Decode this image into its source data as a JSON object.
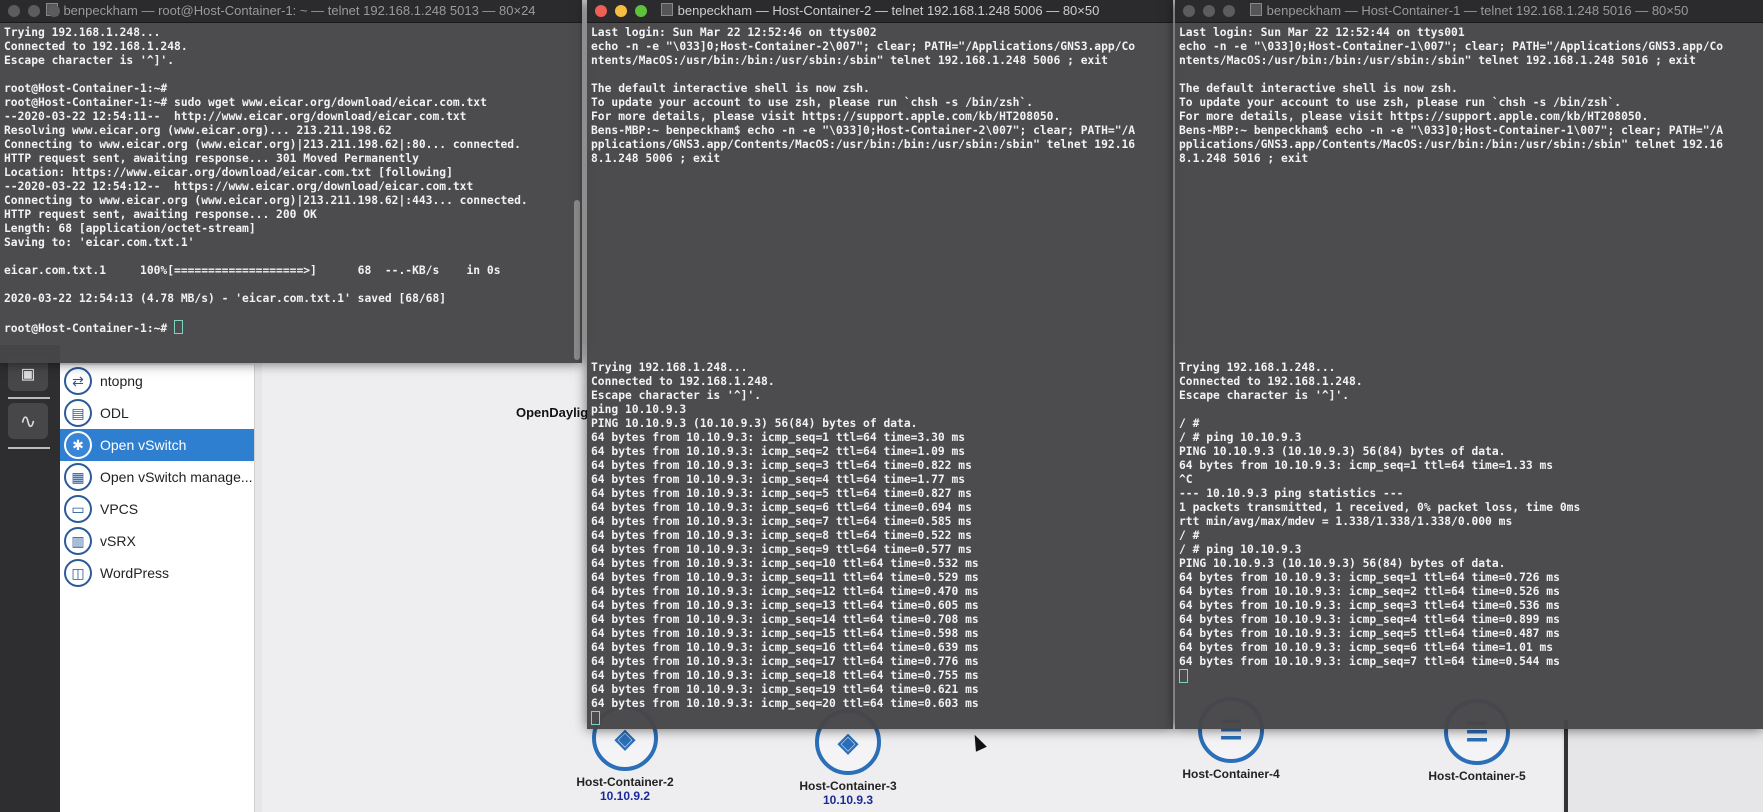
{
  "windows": [
    {
      "title": "benpeckham — root@Host-Container-1: ~ — telnet 192.168.1.248 5013 — 80×24",
      "lines_a": [
        "Trying 192.168.1.248...",
        "Connected to 192.168.1.248.",
        "Escape character is '^]'.",
        "",
        "root@Host-Container-1:~#",
        "root@Host-Container-1:~# sudo wget www.eicar.org/download/eicar.com.txt",
        "--2020-03-22 12:54:11--  http://www.eicar.org/download/eicar.com.txt",
        "Resolving www.eicar.org (www.eicar.org)... 213.211.198.62",
        "Connecting to www.eicar.org (www.eicar.org)|213.211.198.62|:80... connected.",
        "HTTP request sent, awaiting response... 301 Moved Permanently",
        "Location: https://www.eicar.org/download/eicar.com.txt [following]",
        "--2020-03-22 12:54:12--  https://www.eicar.org/download/eicar.com.txt",
        "Connecting to www.eicar.org (www.eicar.org)|213.211.198.62|:443... connected.",
        "HTTP request sent, awaiting response... 200 OK",
        "Length: 68 [application/octet-stream]",
        "Saving to: 'eicar.com.txt.1'",
        "",
        "eicar.com.txt.1     100%[===================>]      68  --.-KB/s    in 0s",
        "",
        "2020-03-22 12:54:13 (4.78 MB/s) - 'eicar.com.txt.1' saved [68/68]",
        "",
        "root@Host-Container-1:~# "
      ]
    },
    {
      "title": "benpeckham — Host-Container-2 — telnet 192.168.1.248 5006 — 80×50",
      "lines_a": [
        "Last login: Sun Mar 22 12:52:46 on ttys002",
        "echo -n -e \"\\033]0;Host-Container-2\\007\"; clear; PATH=\"/Applications/GNS3.app/Co",
        "ntents/MacOS:/usr/bin:/bin:/usr/sbin:/sbin\" telnet 192.168.1.248 5006 ; exit",
        "",
        "The default interactive shell is now zsh.",
        "To update your account to use zsh, please run `chsh -s /bin/zsh`.",
        "For more details, please visit https://support.apple.com/kb/HT208050.",
        "Bens-MBP:~ benpeckham$ echo -n -e \"\\033]0;Host-Container-2\\007\"; clear; PATH=\"/A",
        "pplications/GNS3.app/Contents/MacOS:/usr/bin:/bin:/usr/sbin:/sbin\" telnet 192.16",
        "8.1.248 5006 ; exit"
      ],
      "lines_b": [
        "Trying 192.168.1.248...",
        "Connected to 192.168.1.248.",
        "Escape character is '^]'.",
        "ping 10.10.9.3",
        "PING 10.10.9.3 (10.10.9.3) 56(84) bytes of data.",
        "64 bytes from 10.10.9.3: icmp_seq=1 ttl=64 time=3.30 ms",
        "64 bytes from 10.10.9.3: icmp_seq=2 ttl=64 time=1.09 ms",
        "64 bytes from 10.10.9.3: icmp_seq=3 ttl=64 time=0.822 ms",
        "64 bytes from 10.10.9.3: icmp_seq=4 ttl=64 time=1.77 ms",
        "64 bytes from 10.10.9.3: icmp_seq=5 ttl=64 time=0.827 ms",
        "64 bytes from 10.10.9.3: icmp_seq=6 ttl=64 time=0.694 ms",
        "64 bytes from 10.10.9.3: icmp_seq=7 ttl=64 time=0.585 ms",
        "64 bytes from 10.10.9.3: icmp_seq=8 ttl=64 time=0.522 ms",
        "64 bytes from 10.10.9.3: icmp_seq=9 ttl=64 time=0.577 ms",
        "64 bytes from 10.10.9.3: icmp_seq=10 ttl=64 time=0.532 ms",
        "64 bytes from 10.10.9.3: icmp_seq=11 ttl=64 time=0.529 ms",
        "64 bytes from 10.10.9.3: icmp_seq=12 ttl=64 time=0.470 ms",
        "64 bytes from 10.10.9.3: icmp_seq=13 ttl=64 time=0.605 ms",
        "64 bytes from 10.10.9.3: icmp_seq=14 ttl=64 time=0.708 ms",
        "64 bytes from 10.10.9.3: icmp_seq=15 ttl=64 time=0.598 ms",
        "64 bytes from 10.10.9.3: icmp_seq=16 ttl=64 time=0.639 ms",
        "64 bytes from 10.10.9.3: icmp_seq=17 ttl=64 time=0.776 ms",
        "64 bytes from 10.10.9.3: icmp_seq=18 ttl=64 time=0.755 ms",
        "64 bytes from 10.10.9.3: icmp_seq=19 ttl=64 time=0.621 ms",
        "64 bytes from 10.10.9.3: icmp_seq=20 ttl=64 time=0.603 ms"
      ]
    },
    {
      "title": "benpeckham — Host-Container-1 — telnet 192.168.1.248 5016 — 80×50",
      "lines_a": [
        "Last login: Sun Mar 22 12:52:44 on ttys001",
        "echo -n -e \"\\033]0;Host-Container-1\\007\"; clear; PATH=\"/Applications/GNS3.app/Co",
        "ntents/MacOS:/usr/bin:/bin:/usr/sbin:/sbin\" telnet 192.168.1.248 5016 ; exit",
        "",
        "The default interactive shell is now zsh.",
        "To update your account to use zsh, please run `chsh -s /bin/zsh`.",
        "For more details, please visit https://support.apple.com/kb/HT208050.",
        "Bens-MBP:~ benpeckham$ echo -n -e \"\\033]0;Host-Container-1\\007\"; clear; PATH=\"/A",
        "pplications/GNS3.app/Contents/MacOS:/usr/bin:/bin:/usr/sbin:/sbin\" telnet 192.16",
        "8.1.248 5016 ; exit"
      ],
      "lines_b": [
        "Trying 192.168.1.248...",
        "Connected to 192.168.1.248.",
        "Escape character is '^]'.",
        "",
        "/ #",
        "/ # ping 10.10.9.3",
        "PING 10.10.9.3 (10.10.9.3) 56(84) bytes of data.",
        "64 bytes from 10.10.9.3: icmp_seq=1 ttl=64 time=1.33 ms",
        "^C",
        "--- 10.10.9.3 ping statistics ---",
        "1 packets transmitted, 1 received, 0% packet loss, time 0ms",
        "rtt min/avg/max/mdev = 1.338/1.338/1.338/0.000 ms",
        "/ #",
        "/ # ping 10.10.9.3",
        "PING 10.10.9.3 (10.10.9.3) 56(84) bytes of data.",
        "64 bytes from 10.10.9.3: icmp_seq=1 ttl=64 time=0.726 ms",
        "64 bytes from 10.10.9.3: icmp_seq=2 ttl=64 time=0.526 ms",
        "64 bytes from 10.10.9.3: icmp_seq=3 ttl=64 time=0.536 ms",
        "64 bytes from 10.10.9.3: icmp_seq=4 ttl=64 time=0.899 ms",
        "64 bytes from 10.10.9.3: icmp_seq=5 ttl=64 time=0.487 ms",
        "64 bytes from 10.10.9.3: icmp_seq=6 ttl=64 time=1.01 ms",
        "64 bytes from 10.10.9.3: icmp_seq=7 ttl=64 time=0.544 ms"
      ]
    }
  ],
  "device_list": [
    {
      "label": "ntopng",
      "icon": "ntopng-icon"
    },
    {
      "label": "ODL",
      "icon": "odl-icon"
    },
    {
      "label": "Open vSwitch",
      "icon": "open-vswitch-icon",
      "selected": true
    },
    {
      "label": "Open vSwitch manage...",
      "icon": "open-vswitch-management-icon"
    },
    {
      "label": "VPCS",
      "icon": "vpcs-icon"
    },
    {
      "label": "vSRX",
      "icon": "vsrx-icon"
    },
    {
      "label": "WordPress",
      "icon": "wordpress-icon"
    }
  ],
  "canvas": {
    "opendaylight_label": "OpenDaylig",
    "nodes": [
      {
        "name": "Host-Container-2",
        "ip": "10.10.9.2"
      },
      {
        "name": "Host-Container-3",
        "ip": "10.10.9.3"
      },
      {
        "name": "Host-Container-4",
        "ip": ""
      },
      {
        "name": "Host-Container-5",
        "ip": ""
      }
    ]
  },
  "colors": {
    "selection": "#2f7fd1",
    "ip_text": "#1a2a9a",
    "node_ring": "#2a6fb8"
  }
}
